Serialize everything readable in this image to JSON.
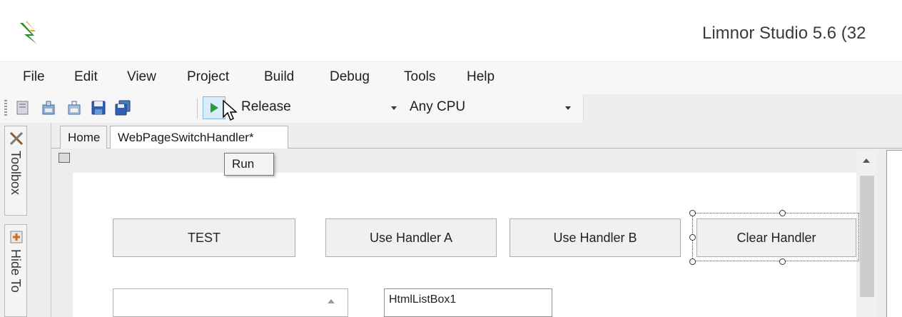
{
  "window": {
    "title": "Limnor Studio 5.6 (32"
  },
  "menu": [
    "File",
    "Edit",
    "View",
    "Project",
    "Build",
    "Debug",
    "Tools",
    "Help"
  ],
  "toolbar": {
    "configuration": "Release",
    "platform": "Any CPU",
    "run_tooltip": "Run"
  },
  "side_tabs": [
    "Toolbox",
    "Hide To"
  ],
  "doc_tabs": {
    "home": "Home",
    "active": "WebPageSwitchHandler*"
  },
  "designer": {
    "buttons": [
      "TEST",
      "Use Handler A",
      "Use Handler B",
      "Clear Handler"
    ],
    "listbox_label": "HtmlListBox1"
  }
}
